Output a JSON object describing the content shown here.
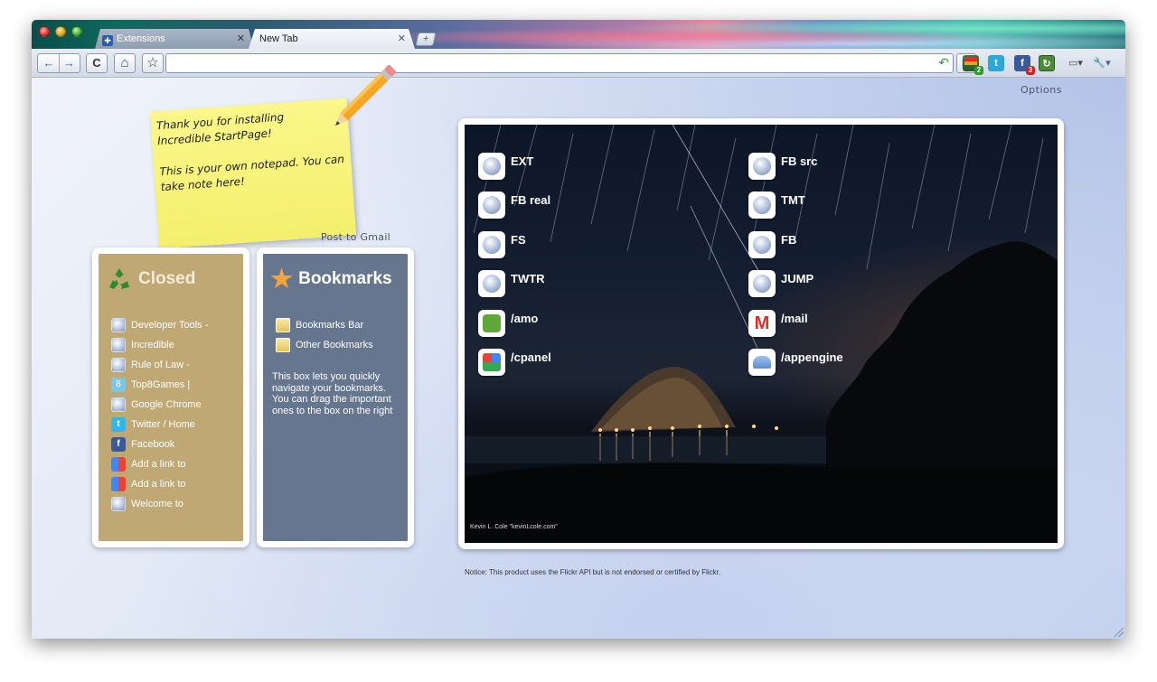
{
  "tabs": [
    {
      "label": "Extensions",
      "icon": "puzzle-icon",
      "active": false
    },
    {
      "label": "New Tab",
      "active": true
    }
  ],
  "toolbar": {
    "back": "←",
    "forward": "→",
    "reload": "C",
    "home": "⌂",
    "star": "☆",
    "omnibox_value": "",
    "extensions": [
      {
        "name": "bookmarks-extension",
        "badge": "2",
        "badge_color": "#2a9a2a"
      },
      {
        "name": "twitter-extension"
      },
      {
        "name": "facebook-extension",
        "badge": "3",
        "badge_color": "#d02020"
      },
      {
        "name": "refresh-extension"
      }
    ]
  },
  "content": {
    "options": "Options",
    "note": {
      "lines": [
        "Thank you for installing",
        "Incredible StartPage!",
        "",
        "This is your own notepad. You can",
        "take note here!"
      ]
    },
    "post_to_gmail": "Post to Gmail",
    "closed": {
      "title": "Closed",
      "items": [
        {
          "label": "Developer Tools -",
          "icon": "globe-icon"
        },
        {
          "label": "Incredible",
          "icon": "globe-icon"
        },
        {
          "label": "Rule of Law -",
          "icon": "globe-icon"
        },
        {
          "label": "Top8Games |",
          "icon": "top8games-icon"
        },
        {
          "label": "Google Chrome",
          "icon": "globe-icon"
        },
        {
          "label": "Twitter / Home",
          "icon": "twitter-icon"
        },
        {
          "label": "Facebook",
          "icon": "facebook-icon"
        },
        {
          "label": "Add a link to",
          "icon": "google-icon"
        },
        {
          "label": "Add a link to",
          "icon": "google-icon"
        },
        {
          "label": "Welcome to",
          "icon": "globe-icon"
        }
      ]
    },
    "bookmarks": {
      "title": "Bookmarks",
      "items": [
        {
          "label": "Bookmarks Bar"
        },
        {
          "label": "Other Bookmarks"
        }
      ],
      "help": "This box lets you quickly navigate your bookmarks. You can drag the important ones to the box on the right"
    },
    "shortcuts_left": [
      {
        "label": "EXT",
        "icon": "globe-icon"
      },
      {
        "label": "FB real",
        "icon": "globe-icon"
      },
      {
        "label": "FS",
        "icon": "globe-icon"
      },
      {
        "label": "TWTR",
        "icon": "globe-icon"
      },
      {
        "label": "/amo",
        "icon": "puzzle-icon"
      },
      {
        "label": "/cpanel",
        "icon": "google-icon"
      }
    ],
    "shortcuts_right": [
      {
        "label": "FB src",
        "icon": "globe-icon"
      },
      {
        "label": "TMT",
        "icon": "globe-icon"
      },
      {
        "label": "FB",
        "icon": "globe-icon"
      },
      {
        "label": "JUMP",
        "icon": "globe-icon"
      },
      {
        "label": "/mail",
        "icon": "gmail-icon"
      },
      {
        "label": "/appengine",
        "icon": "appengine-icon"
      }
    ],
    "photo_credit": "Kevin L. Cole \"kevinLcole.com\"",
    "notice": "Notice: This product uses the Flickr API but is not endorsed or certified by Flickr."
  }
}
